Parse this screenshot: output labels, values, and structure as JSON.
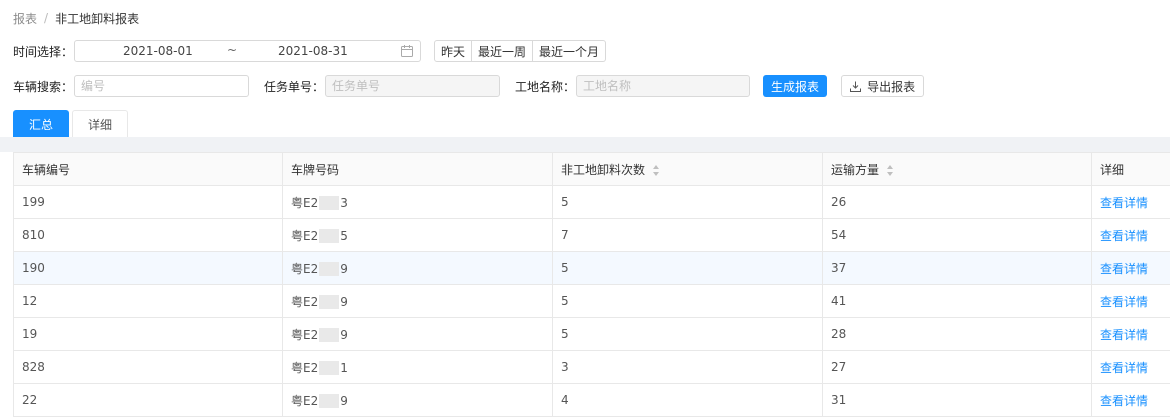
{
  "breadcrumb": {
    "parent": "报表",
    "separator": "/",
    "current": "非工地卸料报表"
  },
  "filters": {
    "time_label": "时间选择：",
    "start_date": "2021-08-01",
    "range_separator": "~",
    "end_date": "2021-08-31",
    "quick_ranges": [
      "昨天",
      "最近一周",
      "最近一个月"
    ],
    "vehicle_label": "车辆搜索：",
    "vehicle_placeholder": "编号",
    "task_label": "任务单号：",
    "task_placeholder": "任务单号",
    "site_label": "工地名称：",
    "site_placeholder": "工地名称",
    "generate_button": "生成报表",
    "export_button": "导出报表"
  },
  "tabs": [
    {
      "label": "汇总",
      "active": true
    },
    {
      "label": "详细",
      "active": false
    }
  ],
  "table": {
    "columns": [
      "车辆编号",
      "车牌号码",
      "非工地卸料次数",
      "运输方量",
      "详细"
    ],
    "rows": [
      {
        "vehicle_no": "199",
        "plate_prefix": "粤E2",
        "plate_suffix": "3",
        "count": "5",
        "volume": "26",
        "detail": "查看详情"
      },
      {
        "vehicle_no": "810",
        "plate_prefix": "粤E2",
        "plate_suffix": "5",
        "count": "7",
        "volume": "54",
        "detail": "查看详情"
      },
      {
        "vehicle_no": "190",
        "plate_prefix": "粤E2",
        "plate_suffix": "9",
        "count": "5",
        "volume": "37",
        "detail": "查看详情"
      },
      {
        "vehicle_no": "12",
        "plate_prefix": "粤E2",
        "plate_suffix": "9",
        "count": "5",
        "volume": "41",
        "detail": "查看详情"
      },
      {
        "vehicle_no": "19",
        "plate_prefix": "粤E2",
        "plate_suffix": "9",
        "count": "5",
        "volume": "28",
        "detail": "查看详情"
      },
      {
        "vehicle_no": "828",
        "plate_prefix": "粤E2",
        "plate_suffix": "1",
        "count": "3",
        "volume": "27",
        "detail": "查看详情"
      },
      {
        "vehicle_no": "22",
        "plate_prefix": "粤E2",
        "plate_suffix": "9",
        "count": "4",
        "volume": "31",
        "detail": "查看详情"
      }
    ]
  },
  "colors": {
    "primary": "#1890ff",
    "highlight_row": "#f4f9ff"
  }
}
